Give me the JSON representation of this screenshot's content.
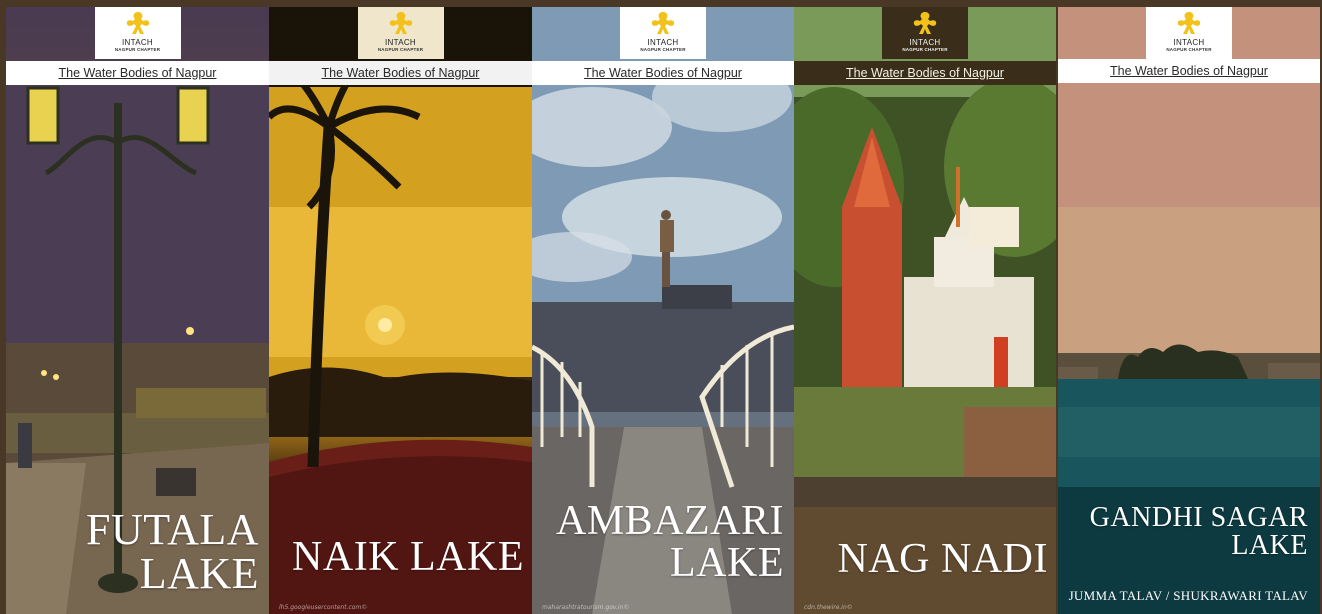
{
  "common": {
    "logo_name": "INTACH",
    "logo_sub": "NAGPUR CHAPTER",
    "series_title": "The Water Bodies of Nagpur"
  },
  "posters": [
    {
      "title_line1": "FUTALA",
      "title_line2": "LAKE",
      "credit": ""
    },
    {
      "title_line1": "NAIK LAKE",
      "credit": "lh5.googleusercontent.com©"
    },
    {
      "title_line1": "AMBAZARI",
      "title_line2": "LAKE",
      "credit": "maharashtratourism.gov.in©"
    },
    {
      "title_line1": "NAG NADI",
      "credit": "cdn.thewire.in©"
    },
    {
      "title_line1": "GANDHI SAGAR",
      "title_line2": "LAKE",
      "subtitle": "JUMMA TALAV / SHUKRAWARI TALAV",
      "credit": ""
    }
  ],
  "colors": {
    "logo_yellow": "#f2c21b",
    "header_bg": "#ffffff",
    "title_text": "#ffffff"
  }
}
